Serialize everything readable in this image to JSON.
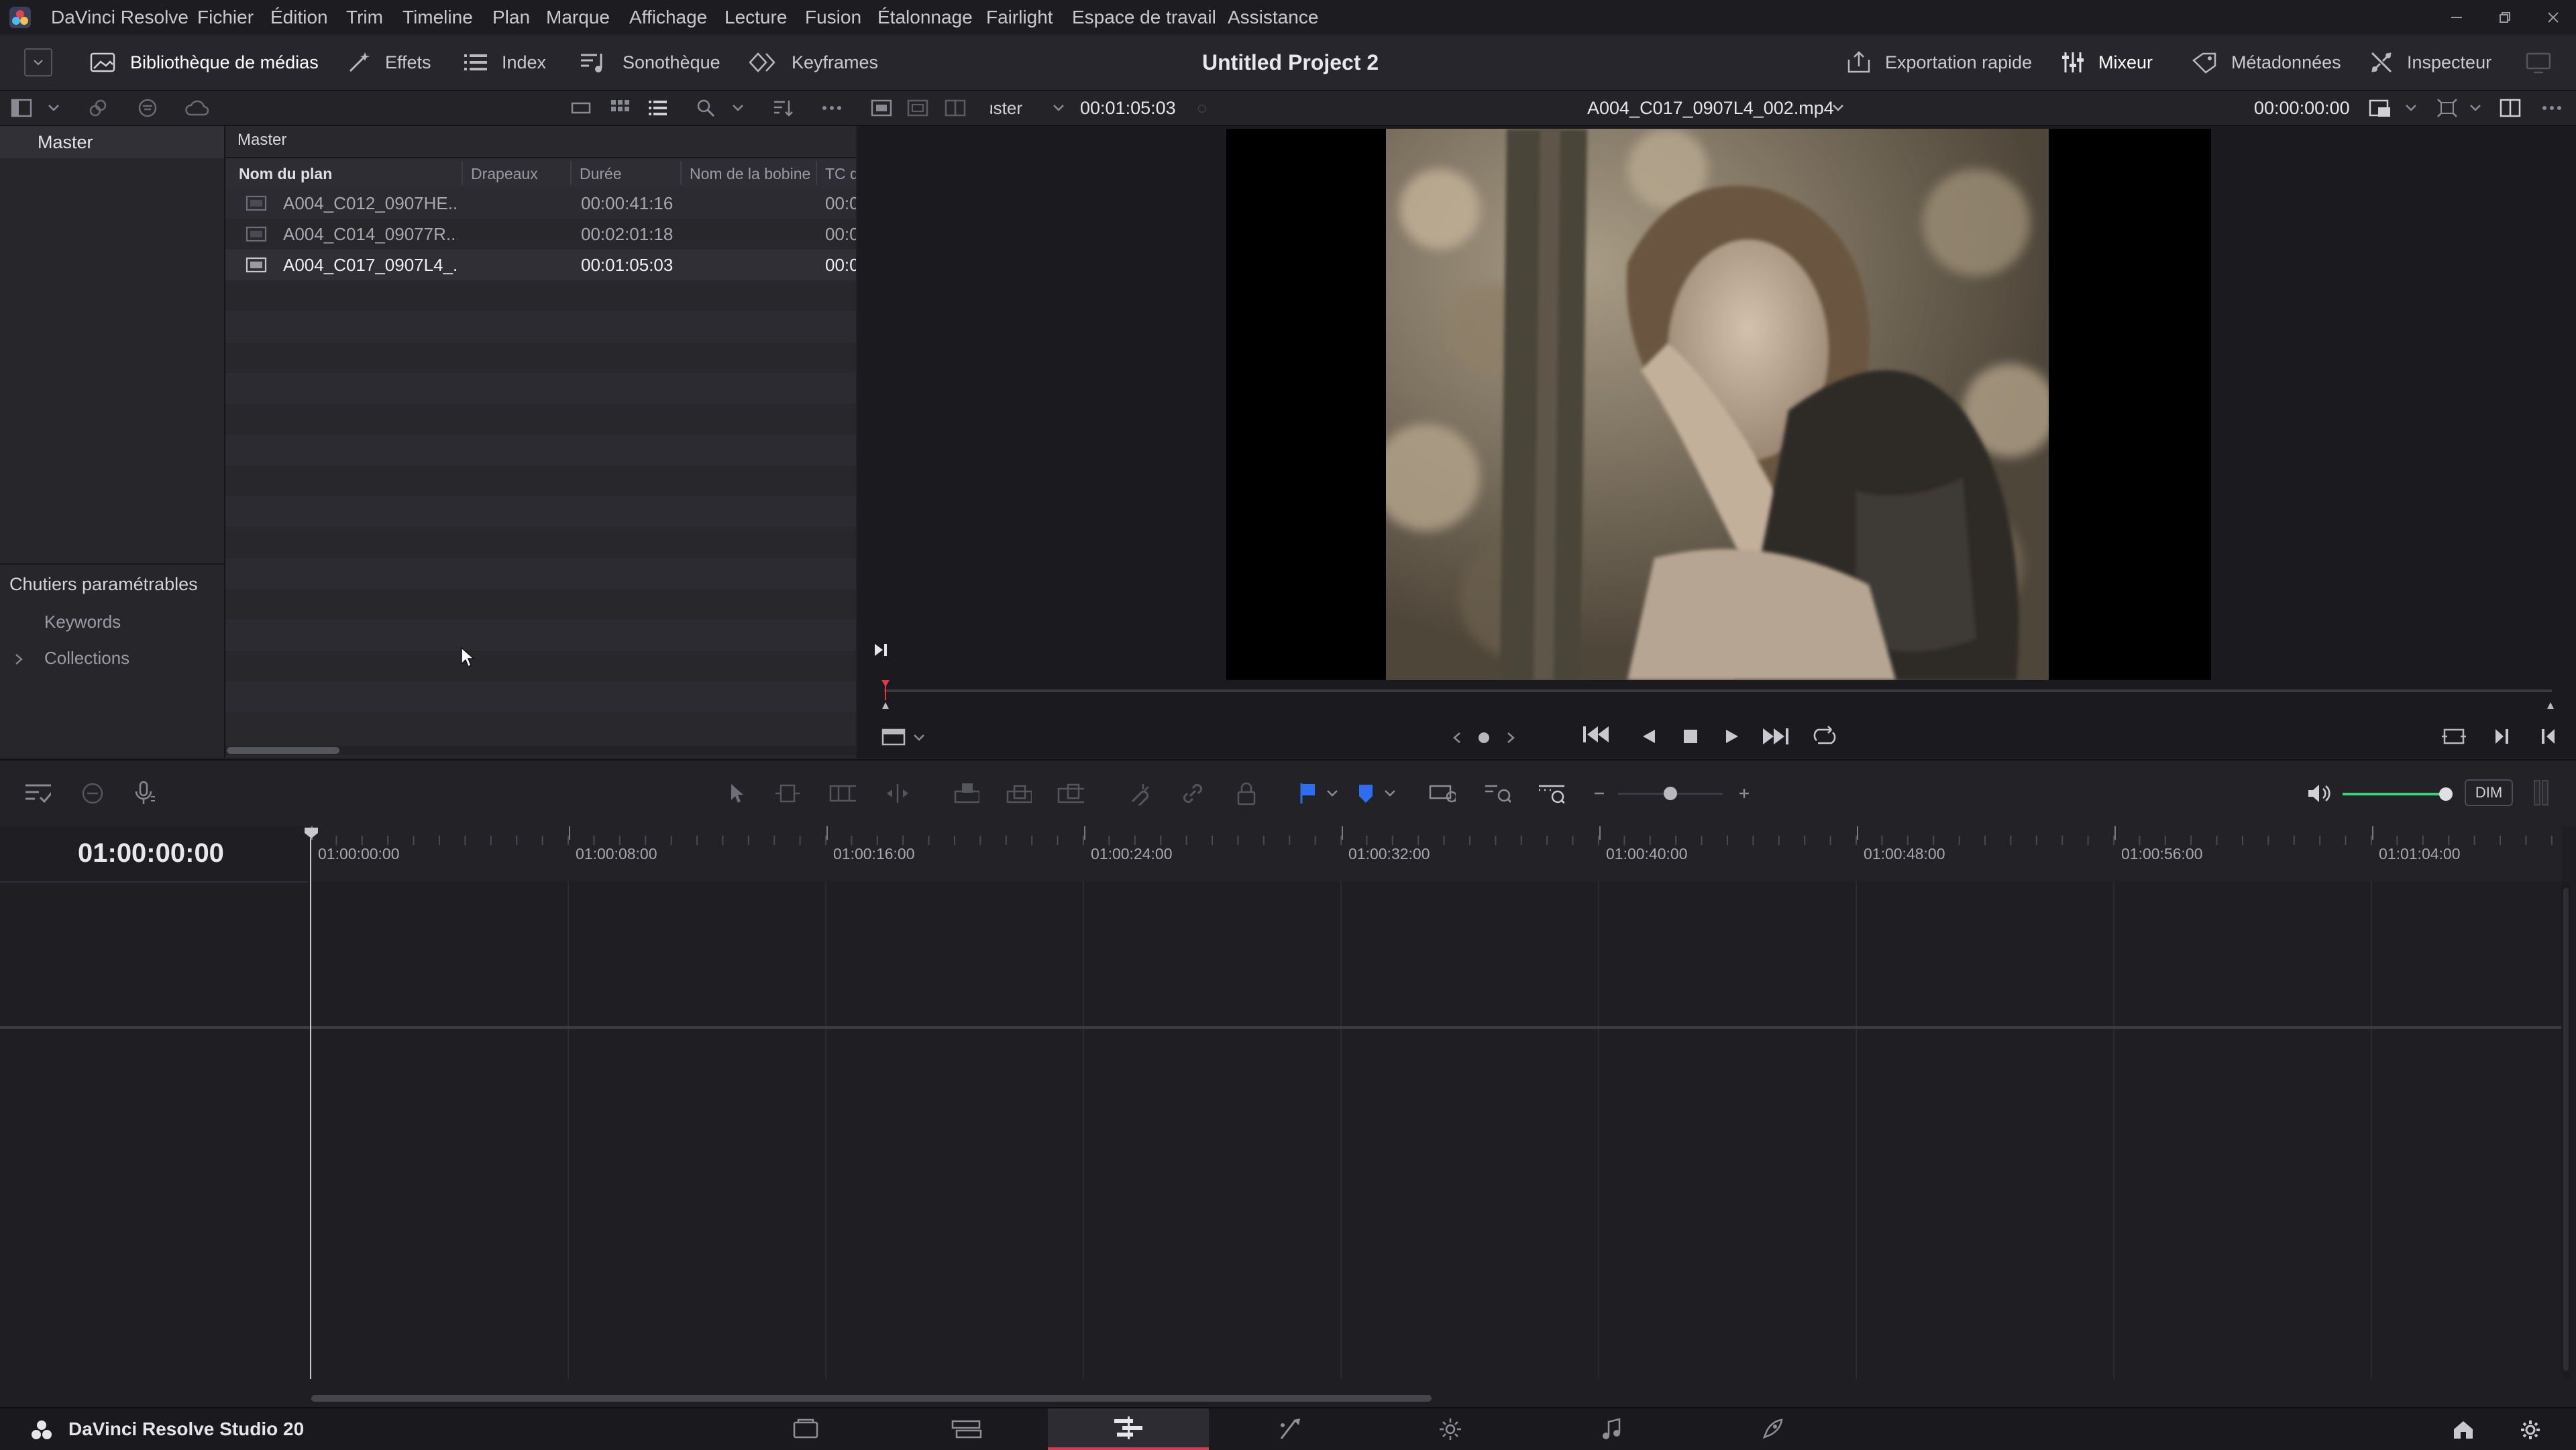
{
  "menubar": {
    "items": [
      "DaVinci Resolve",
      "Fichier",
      "Édition",
      "Trim",
      "Timeline",
      "Plan",
      "Marque",
      "Affichage",
      "Lecture",
      "Fusion",
      "Étalonnage",
      "Fairlight",
      "Espace de travail",
      "Assistance"
    ]
  },
  "toolbar": {
    "media_pool": "Bibliothèque de médias",
    "effects": "Effets",
    "index": "Index",
    "sound_library": "Sonothèque",
    "keyframes": "Keyframes",
    "project_title": "Untitled Project 2",
    "quick_export": "Exportation rapide",
    "mixer": "Mixeur",
    "metadata": "Métadonnées",
    "inspector": "Inspecteur"
  },
  "viewer_bar": {
    "fit": "Ajuster",
    "timecode": "00:01:05:03",
    "clip_name": "A004_C017_0907L4_002.mp4",
    "record_timecode": "00:00:00:00"
  },
  "bins": {
    "master": "Master",
    "smart_bins_title": "Chutiers paramétrables",
    "keywords": "Keywords",
    "collections": "Collections"
  },
  "media_pool": {
    "breadcrumb": "Master",
    "columns": [
      "Nom du plan",
      "Drapeaux",
      "Durée",
      "Nom de la bobine",
      "TC d"
    ],
    "clips": [
      {
        "name": "A004_C012_0907HE...",
        "duration": "00:00:41:16",
        "tc": "00:0"
      },
      {
        "name": "A004_C014_09077R...",
        "duration": "00:02:01:18",
        "tc": "00:0"
      },
      {
        "name": "A004_C017_0907L4_...",
        "duration": "00:01:05:03",
        "tc": "00:0"
      }
    ]
  },
  "timeline": {
    "current_timecode": "01:00:00:00",
    "ruler": [
      "01:00:00:00",
      "01:00:08:00",
      "01:00:16:00",
      "01:00:24:00",
      "01:00:32:00",
      "01:00:40:00",
      "01:00:48:00",
      "01:00:56:00",
      "01:01:04:00"
    ],
    "dim_label": "DIM",
    "zoom_level": 0.5,
    "volume_level": 1.0
  },
  "footer": {
    "app_name": "DaVinci Resolve Studio 20"
  },
  "colors": {
    "accent_red": "#d9394c",
    "flag_blue": "#2f6df0",
    "volume_green": "#3bd07a"
  }
}
